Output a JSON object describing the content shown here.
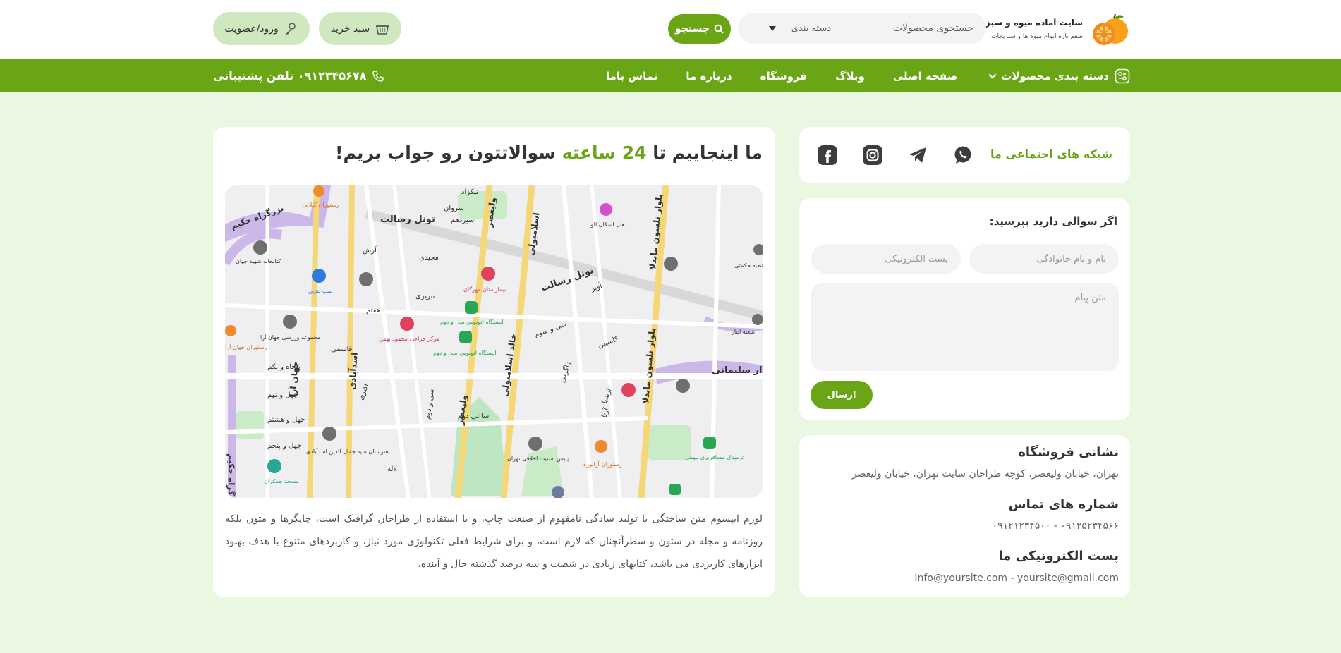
{
  "header": {
    "brand_title": "سایت آماده میوه و سبزیجات",
    "brand_tagline": "طعم تازه انواع میوه ها و سبزیجات",
    "search_placeholder": "جستجوی محصولات",
    "category_label": "دسته بندی",
    "search_button": "جستجو",
    "cart_button": "سبد خرید",
    "login_button": "ورود/عضویت"
  },
  "nav": {
    "items": [
      {
        "label": "دسته بندی محصولات"
      },
      {
        "label": "صفحه اصلی"
      },
      {
        "label": "وبلاگ"
      },
      {
        "label": "فروشگاه"
      },
      {
        "label": "درباره ما"
      },
      {
        "label": "تماس باما"
      }
    ],
    "support_text": "۰۹۱۲۳۴۵۶۷۸ تلفن پشتیبانی"
  },
  "social": {
    "title": "شبکه های اجتماعی ما",
    "icons": [
      "facebook-icon",
      "instagram-icon",
      "telegram-icon",
      "whatsapp-icon"
    ]
  },
  "form": {
    "title": "اگر سوالی دارید بپرسید:",
    "name_placeholder": "نام و نام خانوادگی",
    "email_placeholder": "پست الکترونیکی",
    "message_placeholder": "متن پیام",
    "send_button": "ارسال"
  },
  "info": {
    "address_heading": "نشانی فروشگاه",
    "address_value": "تهران، خیابان ولیعصر، کوچه طراحان سایت تهران، خیابان ولیعصر",
    "phones_heading": "شماره های تماس",
    "phones_value": "۰۹۱۲۵۲۳۴۵۶۶ - ۰۹۱۲۱۲۳۴۵۰۰",
    "email_heading": "پست الکترونیکی ما",
    "email_value": "Info@yoursite.com - yoursite@gmail.com"
  },
  "main": {
    "title_pre": "ما اینجاییم تا ",
    "title_accent": "24 ساعته",
    "title_post": " سوالاتتون رو جواب بریم!",
    "lorem": "لورم ایپسوم متن ساختگی با تولید سادگی نامفهوم از صنعت چاپ، و با استفاده از طراحان گرافیک است، چاپگرها و متون بلکه روزنامه و مجله در ستون و سطرآنچنان که لازم است، و برای شرایط فعلی تکنولوژی مورد نیاز، و کاربردهای متنوع با هدف بهبود ابزارهای کاربردی می باشد، کتابهای زیادی در شصت و سه درصد گذشته حال و آینده،"
  },
  "map": {
    "labels": [
      "تونل رسالت",
      "تونل رسالت",
      "بزرگراه حکیم",
      "بزرگراه حکیم",
      "بلوار نلسون ماندلا",
      "بلوار نلسون ماندلا",
      "ولیعصر",
      "ولیعصر",
      "خالد اسلامبولی",
      "اسلامبولی",
      "سردار سلیمانی",
      "اسدآبادی",
      "جهان آرا",
      "بیمارستان مهرگان",
      "ایستگاه اتوبوس سی و دوم",
      "ایستگاه اتوبوس سی و دوم",
      "مرکز جراحی محمود بهمن",
      "کتابخانه شهید جهان",
      "مجموعه ورزشی جهان آرا",
      "هتل اسکان الوند",
      "ترمینال مسافربری بیهقی",
      "پنجاه و یکم",
      "چهل و نهم",
      "چهل و هشتم",
      "چهل و پنجم",
      "سی و سوم",
      "سی و دوم",
      "آویز",
      "کاسپین",
      "زاگرس",
      "آرتا",
      "ارشیا",
      "ساعی دوم",
      "لاله",
      "سیزدهم",
      "شروان",
      "نیکزاد",
      "هفتم",
      "قاسمی",
      "اکبری",
      "آرش",
      "مجیدی",
      "تبریزی",
      "پایس استیت اخلاقی تهران",
      "هنرستان سید جمال الدین اسدآبادی",
      "رستوران جهان آرا",
      "رستوران گیلانی",
      "رستوران آرانوره",
      "پمپ بنزین",
      "مسجد جمکران",
      "شعبه اینار",
      "شعبه حکمتی"
    ]
  }
}
